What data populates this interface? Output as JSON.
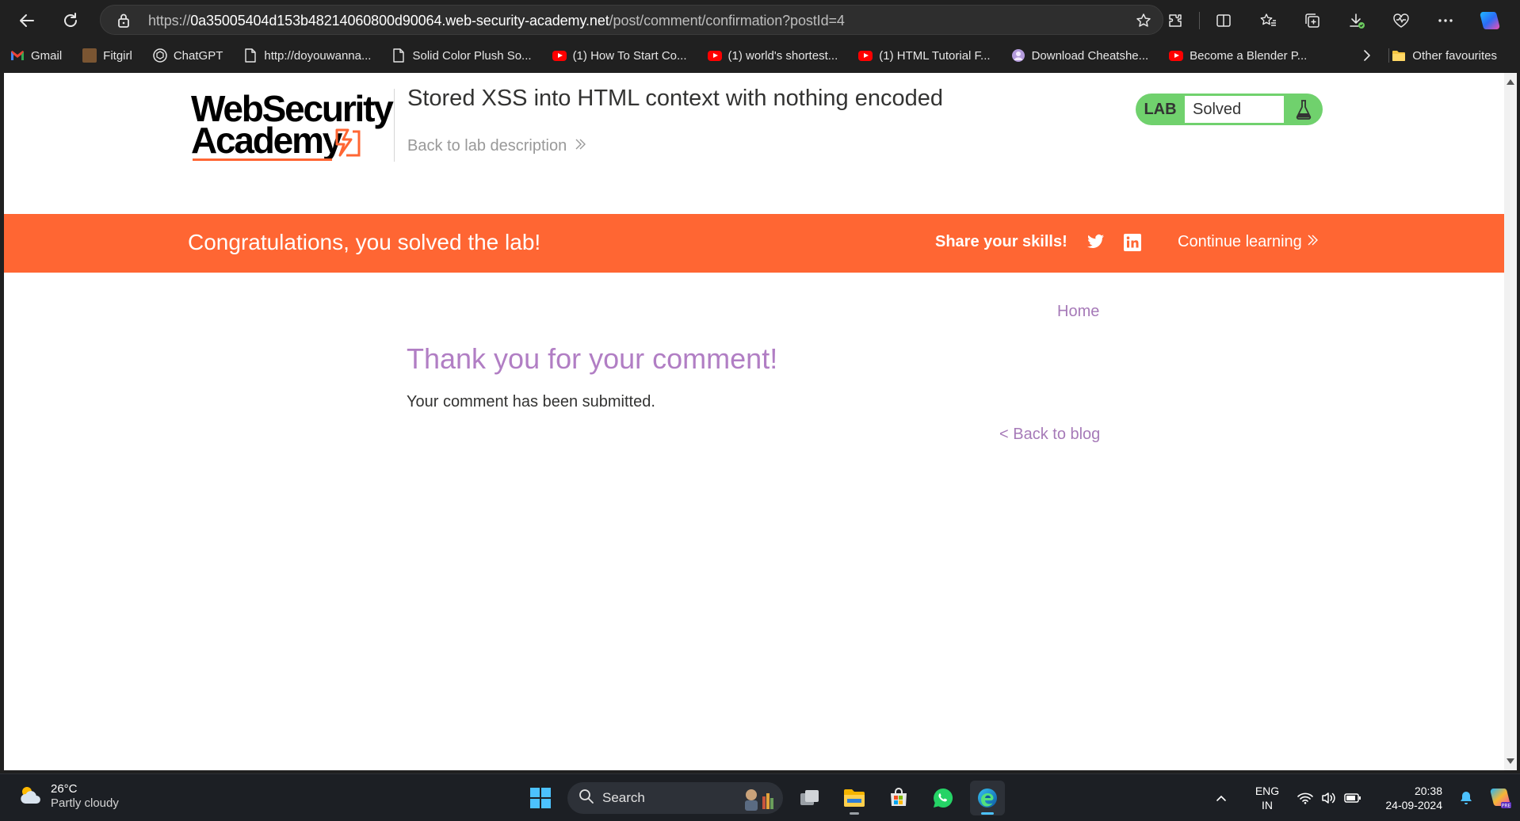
{
  "browser": {
    "url_prefix": "https://",
    "url_host": "0a35005404d153b48214060800d90064.web-security-academy.net",
    "url_path": "/post/comment/confirmation?postId=4",
    "icons": [
      "back-icon",
      "refresh-icon",
      "lock-icon",
      "favorite-star-icon",
      "extensions-icon",
      "split-screen-icon",
      "favorites-icon",
      "collections-icon",
      "downloads-icon",
      "browser-essentials-icon",
      "more-icon",
      "copilot-icon"
    ]
  },
  "bookmarks": {
    "items": [
      {
        "label": "Gmail",
        "icon": "gmail-icon"
      },
      {
        "label": "Fitgirl",
        "icon": "fitgirl-icon"
      },
      {
        "label": "ChatGPT",
        "icon": "chatgpt-icon"
      },
      {
        "label": "http://doyouwanna...",
        "icon": "page-icon"
      },
      {
        "label": "Solid Color Plush So...",
        "icon": "page-icon"
      },
      {
        "label": "(1) How To Start Co...",
        "icon": "youtube-icon"
      },
      {
        "label": "(1) world's shortest...",
        "icon": "youtube-icon"
      },
      {
        "label": "(1) HTML Tutorial F...",
        "icon": "youtube-icon"
      },
      {
        "label": "Download Cheatshe...",
        "icon": "cheatsheet-icon"
      },
      {
        "label": "Become a Blender P...",
        "icon": "youtube-icon"
      }
    ],
    "other_label": "Other favourites"
  },
  "page": {
    "logo_line1": "WebSecurity",
    "logo_line2": "Academy",
    "lab_title": "Stored XSS into HTML context with nothing encoded",
    "back_to_description": "Back to lab description",
    "lab_badge_label": "LAB",
    "lab_status": "Solved",
    "banner": {
      "congrats": "Congratulations, you solved the lab!",
      "share": "Share your skills!",
      "continue": "Continue learning"
    },
    "home_link": "Home",
    "heading": "Thank you for your comment!",
    "message": "Your comment has been submitted.",
    "back_to_blog": "< Back to blog"
  },
  "colors": {
    "accent_orange": "#ff6633",
    "lab_green": "#70d16d",
    "link_purple": "#a67ab8"
  },
  "taskbar": {
    "weather_temp": "26°C",
    "weather_condition": "Partly cloudy",
    "search_placeholder": "Search",
    "lang_line1": "ENG",
    "lang_line2": "IN",
    "time": "20:38",
    "date": "24-09-2024"
  }
}
